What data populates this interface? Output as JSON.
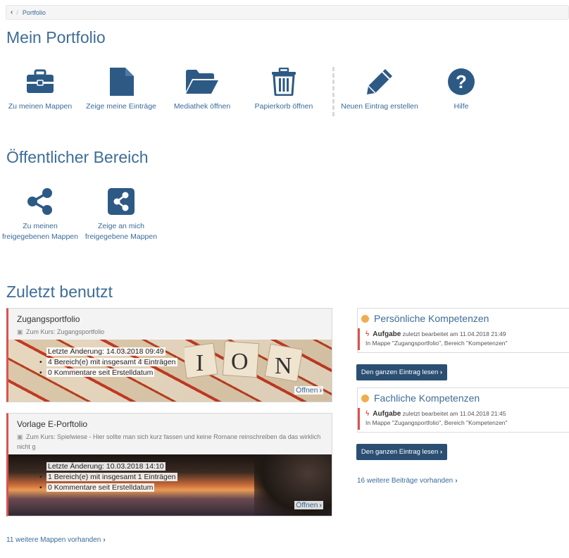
{
  "breadcrumb": {
    "back_glyph": "‹",
    "sep": "/",
    "current": "Portfolio"
  },
  "headings": {
    "portfolio": "Mein Portfolio",
    "public": "Öffentlicher Bereich",
    "recent": "Zuletzt benutzt"
  },
  "tools": [
    {
      "label": "Zu meinen Mappen",
      "icon": "briefcase-icon"
    },
    {
      "label": "Zeige meine Einträge",
      "icon": "document-icon"
    },
    {
      "label": "Mediathek öffnen",
      "icon": "folder-open-icon"
    },
    {
      "label": "Papierkorb öffnen",
      "icon": "trash-icon"
    },
    {
      "label": "Neuen Eintrag erstellen",
      "icon": "pencil-icon"
    },
    {
      "label": "Hilfe",
      "icon": "help-icon"
    }
  ],
  "public_tools": [
    {
      "label": "Zu meinen freigegebenen Mappen",
      "icon": "share-icon"
    },
    {
      "label": "Zeige an mich freigegebene Mappen",
      "icon": "share-square-icon"
    }
  ],
  "folders": [
    {
      "title": "Zugangsportfolio",
      "subtitle": "Zum Kurs: Zugangsportfolio",
      "stats": [
        "Letzte Änderung: 14.03.2018 09:49",
        "4 Bereich(e) mit insgesamt 4 Einträgen",
        "0 Kommentare seit Erstelldatum"
      ],
      "open": "Öffnen"
    },
    {
      "title": "Vorlage E-Porftolio",
      "subtitle": "Zum Kurs: Spielwiese - Hier sollte man sich kurz fassen und keine Romane reinschreiben da das wirklich nicht g",
      "stats": [
        "Letzte Änderung: 10.03.2018 14:10",
        "1 Bereich(e) mit insgesamt 1 Einträgen",
        "0 Kommentare seit Erstelldatum"
      ],
      "open": "Öffnen"
    }
  ],
  "folders_more": "11 weitere Mappen vorhanden",
  "entries": [
    {
      "title": "Persönliche Kompetenzen",
      "type": "Aufgabe",
      "edited": "zuletzt bearbeitet am 11.04.2018 21:49",
      "location": "In Mappe \"Zugangsportfolio\", Bereich \"Kompetenzen\"",
      "button": "Den ganzen Eintrag lesen"
    },
    {
      "title": "Fachliche Kompetenzen",
      "type": "Aufgabe",
      "edited": "zuletzt bearbeitet am 11.04.2018 21:45",
      "location": "In Mappe \"Zugangsportfolio\", Bereich \"Kompetenzen\"",
      "button": "Den ganzen Eintrag lesen"
    }
  ],
  "entries_more": "16 weitere Beiträge vorhanden",
  "colors": {
    "accent": "#3e6d96",
    "link": "#3a6a99",
    "danger": "#d9534f",
    "warning": "#f0ad4e",
    "button": "#2b4f73"
  }
}
